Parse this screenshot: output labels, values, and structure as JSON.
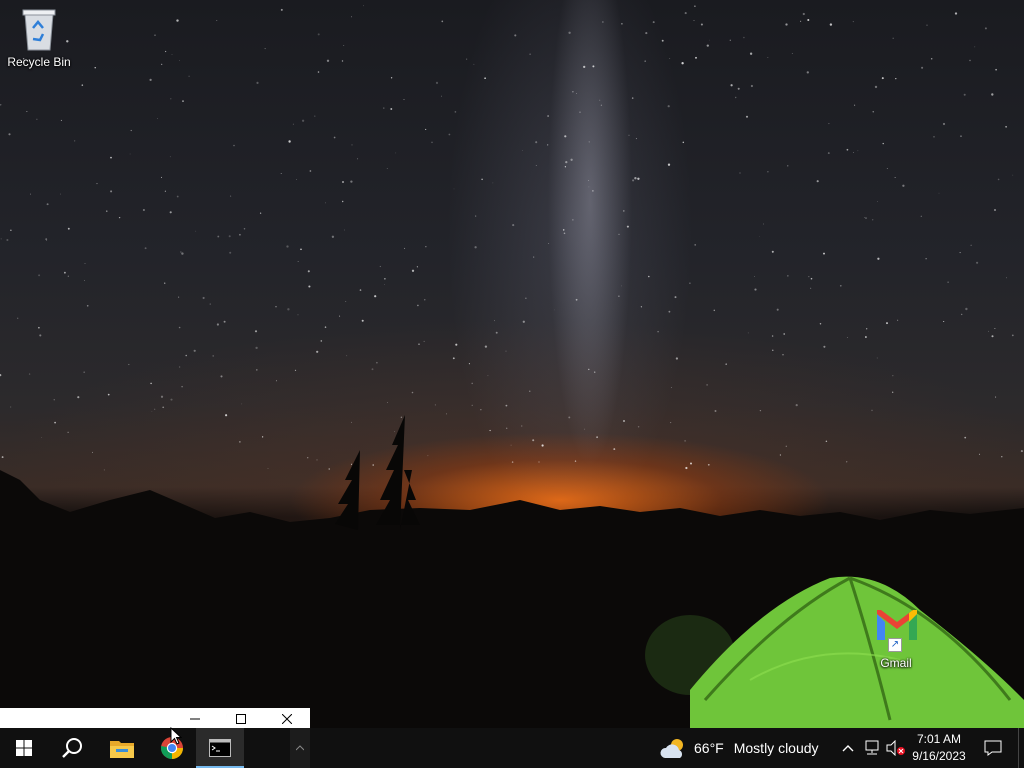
{
  "desktop": {
    "icons": [
      {
        "label": "Recycle Bin",
        "icon": "recycle-bin-icon"
      },
      {
        "label": "Gmail",
        "icon": "gmail-icon"
      }
    ]
  },
  "mini_window": {
    "minimize_label": "minimize",
    "maximize_label": "maximize",
    "close_label": "close"
  },
  "taskbar": {
    "start_icon": "windows-logo-icon",
    "search_icon": "search-icon",
    "pinned": [
      "file-explorer-icon",
      "chrome-icon",
      "command-prompt-icon"
    ],
    "active_app": "command-prompt",
    "weather": {
      "temperature": "66°F",
      "condition": "Mostly cloudy",
      "icon": "partly-cloudy-icon"
    },
    "tray_icons": [
      "chevron-up-icon",
      "network-icon",
      "volume-muted-icon"
    ],
    "clock": {
      "time": "7:01 AM",
      "date": "9/16/2023"
    },
    "notification_icon": "action-center-icon"
  },
  "colors": {
    "taskbar_bg": "#101010",
    "active_underline": "#76b9ed",
    "tent_green": "#6fc53a"
  }
}
